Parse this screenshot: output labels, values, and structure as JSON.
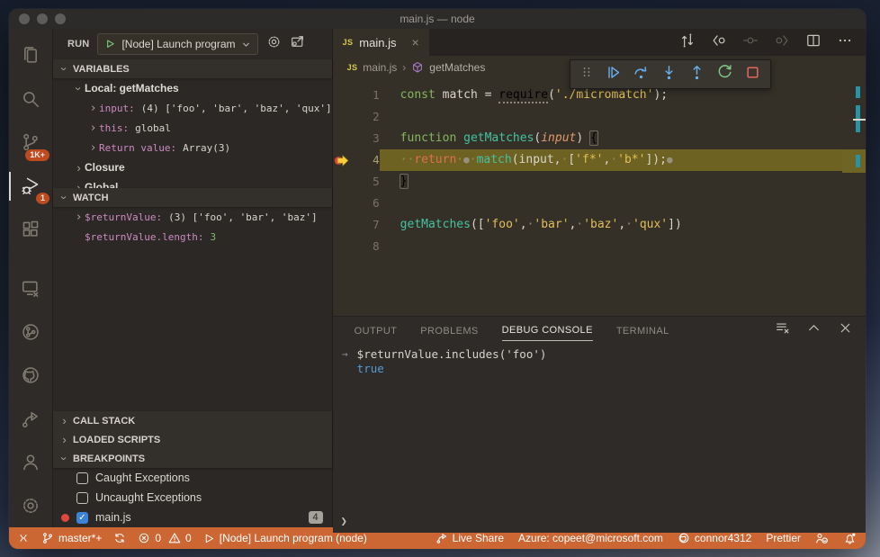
{
  "window": {
    "title": "main.js — node"
  },
  "activity_bar": {
    "items": [
      "explorer",
      "search",
      "source-control",
      "run-and-debug",
      "extensions",
      "remote-explorer",
      "azure",
      "github",
      "live-share",
      "accounts",
      "settings"
    ],
    "scm_badge": "1K+",
    "debug_badge": "1"
  },
  "run_bar": {
    "label": "RUN",
    "config": "[Node] Launch program"
  },
  "sidebar": {
    "variables": {
      "header": "VARIABLES",
      "rows": [
        {
          "indent": 1,
          "arrow": "down",
          "label": "Local: getMatches"
        },
        {
          "indent": 2,
          "arrow": "right",
          "name": "input:",
          "value": "(4) ['foo', 'bar', 'baz', 'qux']"
        },
        {
          "indent": 2,
          "arrow": "right",
          "name": "this:",
          "value": "global"
        },
        {
          "indent": 2,
          "arrow": "right",
          "name": "Return value:",
          "value": "Array(3)"
        },
        {
          "indent": 1,
          "arrow": "right",
          "label": "Closure"
        },
        {
          "indent": 1,
          "arrow": "right",
          "label": "Global"
        }
      ]
    },
    "watch": {
      "header": "WATCH",
      "rows": [
        {
          "indent": 1,
          "arrow": "right",
          "name": "$returnValue:",
          "value": "(3) ['foo', 'bar', 'baz']"
        },
        {
          "indent": 1,
          "arrow": "none",
          "name": "$returnValue.length:",
          "value": "3",
          "valueClass": "num"
        }
      ]
    },
    "call_stack": {
      "header": "CALL STACK"
    },
    "loaded_scripts": {
      "header": "LOADED SCRIPTS"
    },
    "breakpoints": {
      "header": "BREAKPOINTS",
      "items": [
        {
          "label": "Caught Exceptions",
          "checked": false
        },
        {
          "label": "Uncaught Exceptions",
          "checked": false
        },
        {
          "label": "main.js",
          "checked": true,
          "dot": true,
          "badge": "4"
        }
      ]
    }
  },
  "editor": {
    "tab": {
      "icon_text": "JS",
      "label": "main.js",
      "close": "×"
    },
    "actions": [
      "open-changes",
      "navigate-back",
      "debug-reverse",
      "navigate-forward",
      "split-editor",
      "more-actions"
    ],
    "breadcrumbs": {
      "icon_text": "JS",
      "file": "main.js",
      "symbol": "getMatches"
    },
    "debug_toolbar": [
      "drag-grip",
      "continue",
      "step-over",
      "step-into",
      "step-out",
      "restart",
      "stop"
    ],
    "code": {
      "lines": [
        {
          "num": "1",
          "tokens": [
            [
              "kw",
              "const"
            ],
            [
              "v",
              " match "
            ],
            [
              "v",
              "= "
            ],
            [
              "req",
              "require"
            ],
            [
              "v",
              "("
            ],
            [
              "str",
              "'./micromatch'"
            ],
            [
              "v",
              ");"
            ]
          ]
        },
        {
          "num": "2",
          "tokens": []
        },
        {
          "num": "3",
          "tokens": [
            [
              "kw",
              "function"
            ],
            [
              "v",
              " "
            ],
            [
              "fn",
              "getMatches"
            ],
            [
              "v",
              "("
            ],
            [
              "param",
              "input"
            ],
            [
              "v",
              ") "
            ],
            [
              "bm",
              "{"
            ]
          ]
        },
        {
          "num": "4",
          "current": true,
          "tokens": [
            [
              "ws",
              "··"
            ],
            [
              "ret",
              "return"
            ],
            [
              "ws",
              "·"
            ],
            [
              "dot",
              "●"
            ],
            [
              "ws",
              "·"
            ],
            [
              "fn",
              "match"
            ],
            [
              "v",
              "(input,"
            ],
            [
              "ws",
              "·"
            ],
            [
              "v",
              "["
            ],
            [
              "str",
              "'f*'"
            ],
            [
              "v",
              ","
            ],
            [
              "ws",
              "·"
            ],
            [
              "str",
              "'b*'"
            ],
            [
              "v",
              "]);"
            ],
            [
              "dot",
              "●"
            ]
          ]
        },
        {
          "num": "5",
          "tokens": [
            [
              "bm",
              "}"
            ]
          ]
        },
        {
          "num": "6",
          "tokens": []
        },
        {
          "num": "7",
          "tokens": [
            [
              "fn",
              "getMatches"
            ],
            [
              "v",
              "(["
            ],
            [
              "str",
              "'foo'"
            ],
            [
              "v",
              ","
            ],
            [
              "ws",
              "·"
            ],
            [
              "str",
              "'bar'"
            ],
            [
              "v",
              ","
            ],
            [
              "ws",
              "·"
            ],
            [
              "str",
              "'baz'"
            ],
            [
              "v",
              ","
            ],
            [
              "ws",
              "·"
            ],
            [
              "str",
              "'qux'"
            ],
            [
              "v",
              "])"
            ]
          ]
        },
        {
          "num": "8",
          "tokens": []
        }
      ]
    }
  },
  "panel": {
    "tabs": [
      {
        "label": "OUTPUT"
      },
      {
        "label": "PROBLEMS"
      },
      {
        "label": "DEBUG CONSOLE",
        "active": true
      },
      {
        "label": "TERMINAL"
      }
    ],
    "console": {
      "input_arrow": "→",
      "expression": "$returnValue.includes('foo')",
      "result": "true",
      "prompt": "❯"
    }
  },
  "status_bar": {
    "branch": "master*+",
    "errors": "0",
    "warnings": "0",
    "launch": "[Node] Launch program (node)",
    "live_share": "Live Share",
    "azure": "Azure: copeet@microsoft.com",
    "account": "connor4312",
    "prettier": "Prettier"
  },
  "colors": {
    "status_bar": "#cc6633",
    "badge": "#cc4d1e",
    "string": "#e3bf57",
    "keyword": "#85b65e",
    "function_name": "#44c2a1",
    "return_keyword": "#e06e50",
    "variable_name": "#cd8ac2",
    "number": "#82b96a",
    "console_result": "#559cd5",
    "current_line_bg": "#6d6222",
    "breakpoint": "#e0443a",
    "current_arrow": "#ffce3a",
    "checkbox_checked": "#3c82d6"
  }
}
